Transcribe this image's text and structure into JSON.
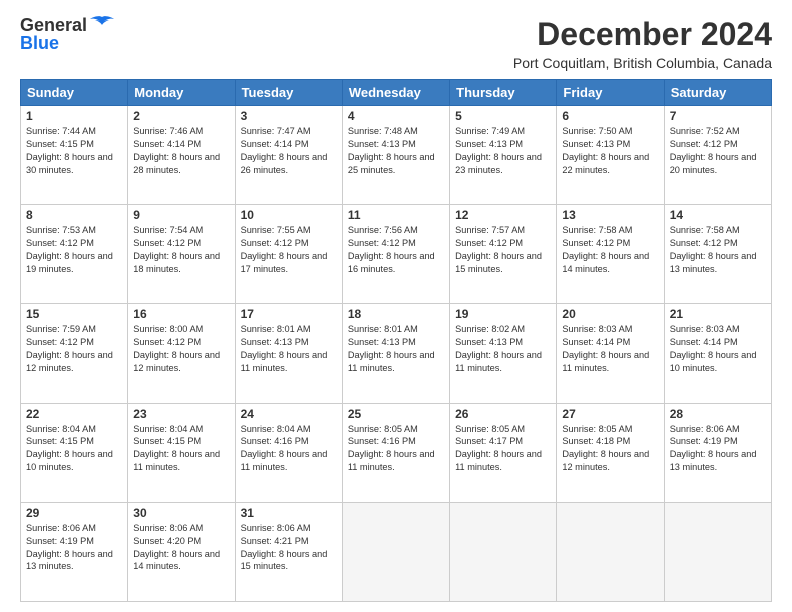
{
  "logo": {
    "line1": "General",
    "line2": "Blue"
  },
  "header": {
    "title": "December 2024",
    "subtitle": "Port Coquitlam, British Columbia, Canada"
  },
  "days_of_week": [
    "Sunday",
    "Monday",
    "Tuesday",
    "Wednesday",
    "Thursday",
    "Friday",
    "Saturday"
  ],
  "weeks": [
    [
      {
        "day": "1",
        "sunrise": "Sunrise: 7:44 AM",
        "sunset": "Sunset: 4:15 PM",
        "daylight": "Daylight: 8 hours and 30 minutes."
      },
      {
        "day": "2",
        "sunrise": "Sunrise: 7:46 AM",
        "sunset": "Sunset: 4:14 PM",
        "daylight": "Daylight: 8 hours and 28 minutes."
      },
      {
        "day": "3",
        "sunrise": "Sunrise: 7:47 AM",
        "sunset": "Sunset: 4:14 PM",
        "daylight": "Daylight: 8 hours and 26 minutes."
      },
      {
        "day": "4",
        "sunrise": "Sunrise: 7:48 AM",
        "sunset": "Sunset: 4:13 PM",
        "daylight": "Daylight: 8 hours and 25 minutes."
      },
      {
        "day": "5",
        "sunrise": "Sunrise: 7:49 AM",
        "sunset": "Sunset: 4:13 PM",
        "daylight": "Daylight: 8 hours and 23 minutes."
      },
      {
        "day": "6",
        "sunrise": "Sunrise: 7:50 AM",
        "sunset": "Sunset: 4:13 PM",
        "daylight": "Daylight: 8 hours and 22 minutes."
      },
      {
        "day": "7",
        "sunrise": "Sunrise: 7:52 AM",
        "sunset": "Sunset: 4:12 PM",
        "daylight": "Daylight: 8 hours and 20 minutes."
      }
    ],
    [
      {
        "day": "8",
        "sunrise": "Sunrise: 7:53 AM",
        "sunset": "Sunset: 4:12 PM",
        "daylight": "Daylight: 8 hours and 19 minutes."
      },
      {
        "day": "9",
        "sunrise": "Sunrise: 7:54 AM",
        "sunset": "Sunset: 4:12 PM",
        "daylight": "Daylight: 8 hours and 18 minutes."
      },
      {
        "day": "10",
        "sunrise": "Sunrise: 7:55 AM",
        "sunset": "Sunset: 4:12 PM",
        "daylight": "Daylight: 8 hours and 17 minutes."
      },
      {
        "day": "11",
        "sunrise": "Sunrise: 7:56 AM",
        "sunset": "Sunset: 4:12 PM",
        "daylight": "Daylight: 8 hours and 16 minutes."
      },
      {
        "day": "12",
        "sunrise": "Sunrise: 7:57 AM",
        "sunset": "Sunset: 4:12 PM",
        "daylight": "Daylight: 8 hours and 15 minutes."
      },
      {
        "day": "13",
        "sunrise": "Sunrise: 7:58 AM",
        "sunset": "Sunset: 4:12 PM",
        "daylight": "Daylight: 8 hours and 14 minutes."
      },
      {
        "day": "14",
        "sunrise": "Sunrise: 7:58 AM",
        "sunset": "Sunset: 4:12 PM",
        "daylight": "Daylight: 8 hours and 13 minutes."
      }
    ],
    [
      {
        "day": "15",
        "sunrise": "Sunrise: 7:59 AM",
        "sunset": "Sunset: 4:12 PM",
        "daylight": "Daylight: 8 hours and 12 minutes."
      },
      {
        "day": "16",
        "sunrise": "Sunrise: 8:00 AM",
        "sunset": "Sunset: 4:12 PM",
        "daylight": "Daylight: 8 hours and 12 minutes."
      },
      {
        "day": "17",
        "sunrise": "Sunrise: 8:01 AM",
        "sunset": "Sunset: 4:13 PM",
        "daylight": "Daylight: 8 hours and 11 minutes."
      },
      {
        "day": "18",
        "sunrise": "Sunrise: 8:01 AM",
        "sunset": "Sunset: 4:13 PM",
        "daylight": "Daylight: 8 hours and 11 minutes."
      },
      {
        "day": "19",
        "sunrise": "Sunrise: 8:02 AM",
        "sunset": "Sunset: 4:13 PM",
        "daylight": "Daylight: 8 hours and 11 minutes."
      },
      {
        "day": "20",
        "sunrise": "Sunrise: 8:03 AM",
        "sunset": "Sunset: 4:14 PM",
        "daylight": "Daylight: 8 hours and 11 minutes."
      },
      {
        "day": "21",
        "sunrise": "Sunrise: 8:03 AM",
        "sunset": "Sunset: 4:14 PM",
        "daylight": "Daylight: 8 hours and 10 minutes."
      }
    ],
    [
      {
        "day": "22",
        "sunrise": "Sunrise: 8:04 AM",
        "sunset": "Sunset: 4:15 PM",
        "daylight": "Daylight: 8 hours and 10 minutes."
      },
      {
        "day": "23",
        "sunrise": "Sunrise: 8:04 AM",
        "sunset": "Sunset: 4:15 PM",
        "daylight": "Daylight: 8 hours and 11 minutes."
      },
      {
        "day": "24",
        "sunrise": "Sunrise: 8:04 AM",
        "sunset": "Sunset: 4:16 PM",
        "daylight": "Daylight: 8 hours and 11 minutes."
      },
      {
        "day": "25",
        "sunrise": "Sunrise: 8:05 AM",
        "sunset": "Sunset: 4:16 PM",
        "daylight": "Daylight: 8 hours and 11 minutes."
      },
      {
        "day": "26",
        "sunrise": "Sunrise: 8:05 AM",
        "sunset": "Sunset: 4:17 PM",
        "daylight": "Daylight: 8 hours and 11 minutes."
      },
      {
        "day": "27",
        "sunrise": "Sunrise: 8:05 AM",
        "sunset": "Sunset: 4:18 PM",
        "daylight": "Daylight: 8 hours and 12 minutes."
      },
      {
        "day": "28",
        "sunrise": "Sunrise: 8:06 AM",
        "sunset": "Sunset: 4:19 PM",
        "daylight": "Daylight: 8 hours and 13 minutes."
      }
    ],
    [
      {
        "day": "29",
        "sunrise": "Sunrise: 8:06 AM",
        "sunset": "Sunset: 4:19 PM",
        "daylight": "Daylight: 8 hours and 13 minutes."
      },
      {
        "day": "30",
        "sunrise": "Sunrise: 8:06 AM",
        "sunset": "Sunset: 4:20 PM",
        "daylight": "Daylight: 8 hours and 14 minutes."
      },
      {
        "day": "31",
        "sunrise": "Sunrise: 8:06 AM",
        "sunset": "Sunset: 4:21 PM",
        "daylight": "Daylight: 8 hours and 15 minutes."
      },
      null,
      null,
      null,
      null
    ]
  ]
}
